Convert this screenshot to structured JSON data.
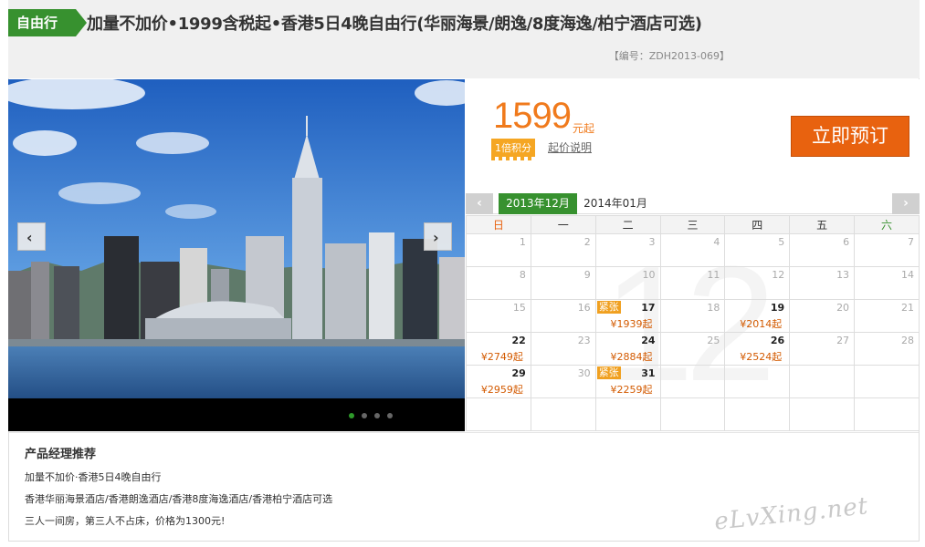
{
  "header": {
    "tag": "自由行",
    "title": "加量不加价•1999含税起•香港5日4晚自由行(华丽海景/朗逸/8度海逸/柏宁酒店可选)",
    "code": "【编号：ZDH2013-069】"
  },
  "photo": {
    "prev_label": "‹",
    "next_label": "›",
    "dots": 4,
    "active_dot": 0
  },
  "price": {
    "amount": "1599",
    "unit": "元起",
    "points": "1倍积分",
    "note": "起价说明",
    "book_label": "立即预订"
  },
  "calendar": {
    "prev": "‹",
    "next": "›",
    "active_month": "2013年12月",
    "next_month": "2014年01月",
    "watermark": "12",
    "weekdays": [
      "日",
      "一",
      "二",
      "三",
      "四",
      "五",
      "六"
    ],
    "weeks": [
      [
        {
          "d": "1"
        },
        {
          "d": "2"
        },
        {
          "d": "3"
        },
        {
          "d": "4"
        },
        {
          "d": "5"
        },
        {
          "d": "6"
        },
        {
          "d": "7"
        }
      ],
      [
        {
          "d": "8"
        },
        {
          "d": "9"
        },
        {
          "d": "10"
        },
        {
          "d": "11"
        },
        {
          "d": "12"
        },
        {
          "d": "13"
        },
        {
          "d": "14"
        }
      ],
      [
        {
          "d": "15"
        },
        {
          "d": "16"
        },
        {
          "d": "17",
          "avail": true,
          "hot": "紧张",
          "price": "¥1939起"
        },
        {
          "d": "18"
        },
        {
          "d": "19",
          "avail": true,
          "price": "¥2014起"
        },
        {
          "d": "20"
        },
        {
          "d": "21"
        }
      ],
      [
        {
          "d": "22",
          "avail": true,
          "price": "¥2749起"
        },
        {
          "d": "23"
        },
        {
          "d": "24",
          "avail": true,
          "price": "¥2884起"
        },
        {
          "d": "25"
        },
        {
          "d": "26",
          "avail": true,
          "price": "¥2524起"
        },
        {
          "d": "27"
        },
        {
          "d": "28"
        }
      ],
      [
        {
          "d": "29",
          "avail": true,
          "price": "¥2959起"
        },
        {
          "d": "30"
        },
        {
          "d": "31",
          "avail": true,
          "hot": "紧张",
          "price": "¥2259起"
        },
        {
          "d": ""
        },
        {
          "d": ""
        },
        {
          "d": ""
        },
        {
          "d": ""
        }
      ],
      [
        {
          "d": ""
        },
        {
          "d": ""
        },
        {
          "d": ""
        },
        {
          "d": ""
        },
        {
          "d": ""
        },
        {
          "d": ""
        },
        {
          "d": ""
        }
      ]
    ]
  },
  "recommend": {
    "title": "产品经理推荐",
    "line1": "加量不加价·香港5日4晚自由行",
    "line2": "香港华丽海景酒店/香港朗逸酒店/香港8度海逸酒店/香港柏宁酒店可选",
    "line3": "三人一间房，第三人不占床，价格为1300元!",
    "watermark": "eLvXing.net"
  },
  "colors": {
    "green": "#37912f",
    "orange": "#e8620f",
    "price_orange": "#f07a1c"
  }
}
